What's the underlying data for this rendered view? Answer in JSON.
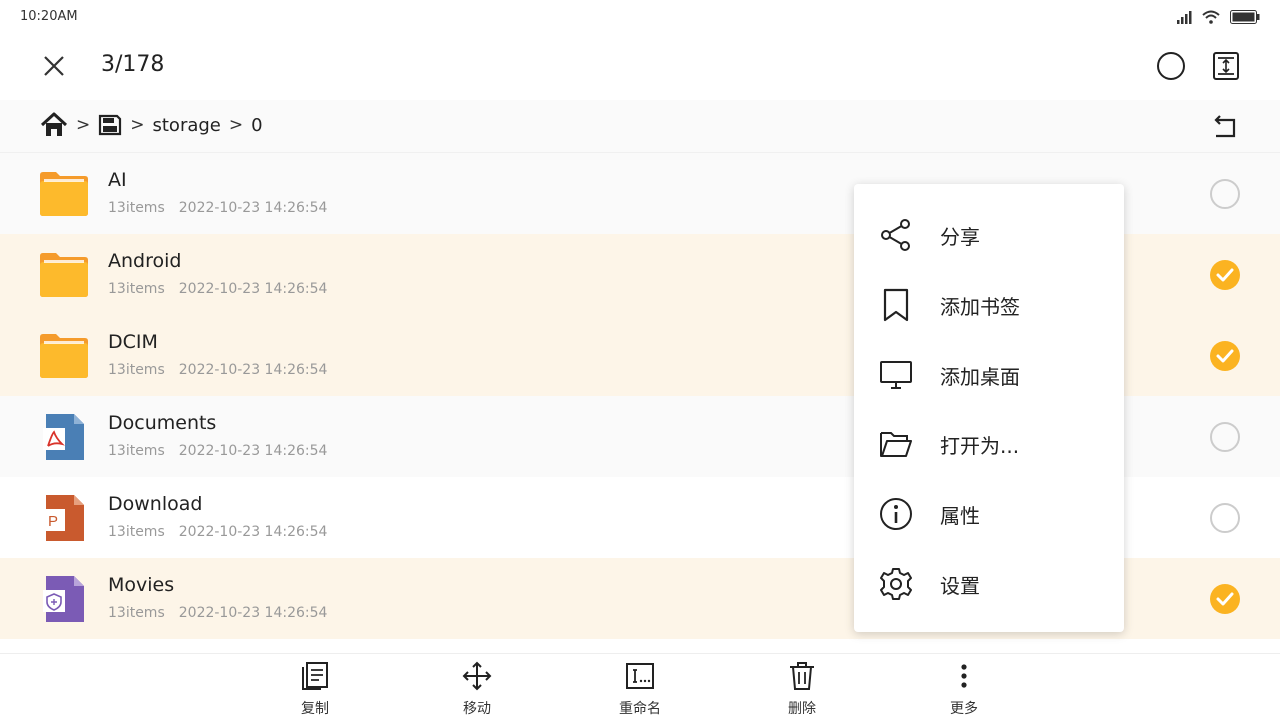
{
  "status": {
    "time": "10:20AM"
  },
  "header": {
    "count": "3/178"
  },
  "breadcrumb": {
    "sep1": ">",
    "sep2": ">",
    "part1": "storage",
    "sep3": ">",
    "part2": "0"
  },
  "files": [
    {
      "name": "AI",
      "items": "13items",
      "date": "2022-10-23 14:26:54",
      "type": "folder",
      "selected": false
    },
    {
      "name": "Android",
      "items": "13items",
      "date": "2022-10-23 14:26:54",
      "type": "folder",
      "selected": true
    },
    {
      "name": "DCIM",
      "items": "13items",
      "date": "2022-10-23 14:26:54",
      "type": "folder",
      "selected": true
    },
    {
      "name": "Documents",
      "items": "13items",
      "date": "2022-10-23 14:26:54",
      "type": "pdf",
      "selected": false
    },
    {
      "name": "Download",
      "items": "13items",
      "date": "2022-10-23 14:26:54",
      "type": "ppt",
      "selected": false
    },
    {
      "name": "Movies",
      "items": "13items",
      "date": "2022-10-23 14:26:54",
      "type": "secure",
      "selected": true
    }
  ],
  "menu": {
    "items": [
      {
        "label": "分享",
        "icon": "share-icon"
      },
      {
        "label": "添加书签",
        "icon": "bookmark-icon"
      },
      {
        "label": "添加桌面",
        "icon": "desktop-icon"
      },
      {
        "label": "打开为...",
        "icon": "folder-open-icon"
      },
      {
        "label": "属性",
        "icon": "info-icon"
      },
      {
        "label": "设置",
        "icon": "gear-icon"
      }
    ]
  },
  "toolbar": {
    "copy": "复制",
    "move": "移动",
    "rename": "重命名",
    "delete": "删除",
    "more": "更多"
  },
  "colors": {
    "accent": "#FBB321",
    "folder": "#FDBA2C",
    "pdf": "#4A7FB5",
    "ppt": "#C95A2E",
    "secure": "#7B5BB5"
  }
}
